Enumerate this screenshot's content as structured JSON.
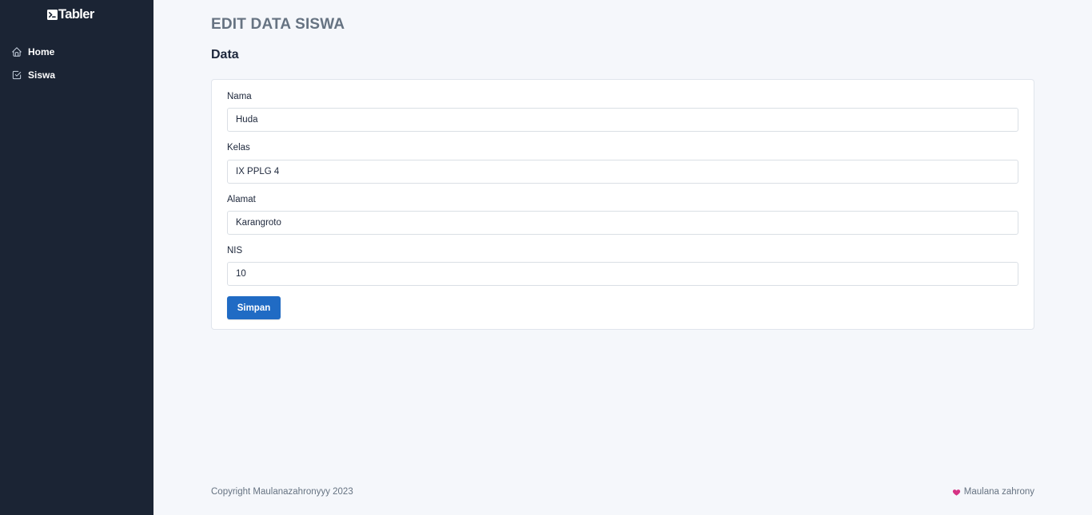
{
  "brand": {
    "name": "Tabler"
  },
  "sidebar": {
    "items": [
      {
        "label": "Home",
        "icon": "home-icon"
      },
      {
        "label": "Siswa",
        "icon": "checkbox-icon"
      }
    ]
  },
  "header": {
    "pretitle": "EDIT DATA SISWA",
    "title": "Data"
  },
  "form": {
    "nama": {
      "label": "Nama",
      "value": "Huda"
    },
    "kelas": {
      "label": "Kelas",
      "value": "IX PPLG 4"
    },
    "alamat": {
      "label": "Alamat",
      "value": "Karangroto"
    },
    "nis": {
      "label": "NIS",
      "value": "10"
    },
    "submit_label": "Simpan"
  },
  "footer": {
    "copyright": "Copyright Maulanazahronyyy 2023",
    "author": "Maulana zahrony",
    "author_icon": "heart-icon"
  },
  "colors": {
    "sidebar_bg": "#1b2434",
    "page_bg": "#f5f7fb",
    "primary": "#206bc4",
    "heart": "#d63939",
    "muted": "#667382"
  }
}
